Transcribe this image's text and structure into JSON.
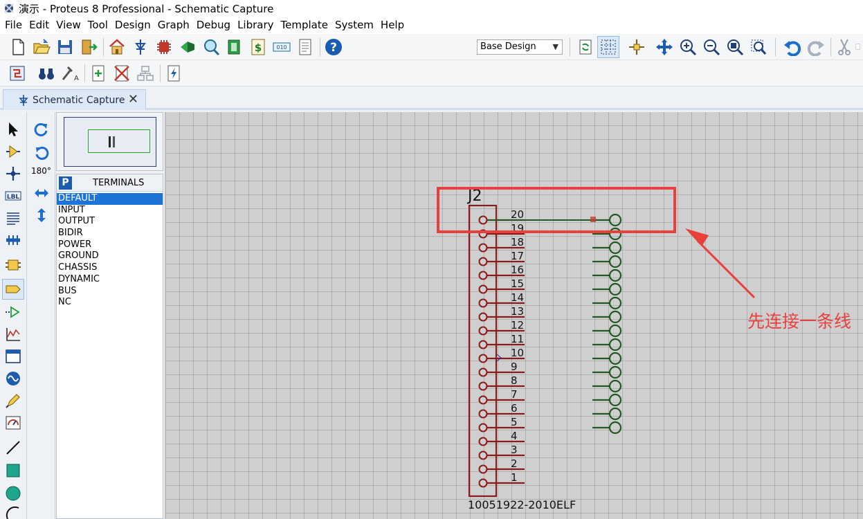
{
  "window": {
    "title": "演示 - Proteus 8 Professional - Schematic Capture"
  },
  "menu": [
    "File",
    "Edit",
    "View",
    "Tool",
    "Design",
    "Graph",
    "Debug",
    "Library",
    "Template",
    "System",
    "Help"
  ],
  "toolbar": {
    "layer_select_value": "Base Design"
  },
  "tab": {
    "label": "Schematic Capture",
    "close": "✕"
  },
  "left_tools": {
    "rotation_label": "180°",
    "label_tool_text": "LBL"
  },
  "selector": {
    "mode_button": "P",
    "title": "TERMINALS",
    "items": [
      "DEFAULT",
      "INPUT",
      "OUTPUT",
      "BIDIR",
      "POWER",
      "GROUND",
      "CHASSIS",
      "DYNAMIC",
      "BUS",
      "NC"
    ],
    "selected_index": 0
  },
  "schematic": {
    "component_ref": "J2",
    "component_value": "10051922-2010ELF",
    "pin_numbers": [
      "20",
      "19",
      "18",
      "17",
      "16",
      "15",
      "14",
      "13",
      "12",
      "11",
      "10",
      "9",
      "8",
      "7",
      "6",
      "5",
      "4",
      "3",
      "2",
      "1"
    ],
    "terminal_count": 16,
    "connected_wires": 1
  },
  "annotation": {
    "text": "先连接一条线",
    "color": "#e8413c"
  },
  "colors": {
    "component": "#8b1a1a",
    "terminal": "#1f5a1f",
    "wire": "#1f5a1f",
    "highlight": "#e8413c"
  }
}
